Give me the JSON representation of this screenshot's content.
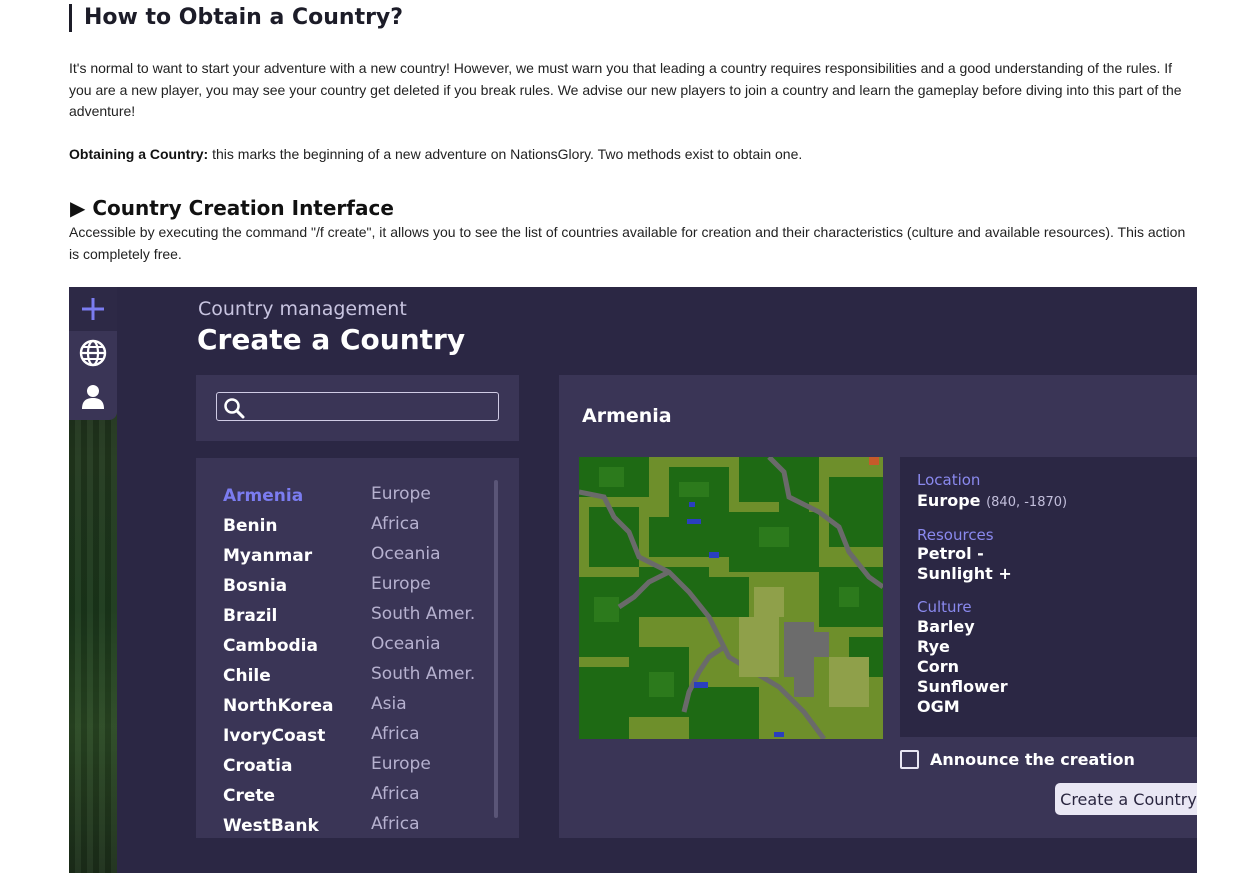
{
  "article": {
    "heading": "How to Obtain a Country?",
    "intro": "It's normal to want to start your adventure with a new country! However, we must warn you that leading a country requires responsibilities and a good understanding of the rules. If you are a new player, you may see your country get deleted if you break rules. We advise our new players to join a country and learn the gameplay before diving into this part of the adventure!",
    "obtaining_label": "Obtaining a Country:",
    "obtaining_text": " this marks the beginning of a new adventure on NationsGlory. Two methods exist to obtain one.",
    "section_title": "▶ Country Creation Interface",
    "section_text": "Accessible by executing the command \"/f create\", it allows you to see the list of countries available for creation and their characteristics (culture and available resources). This action is completely free."
  },
  "game_ui": {
    "subtitle": "Country management",
    "title": "Create a Country",
    "search": {
      "value": "",
      "placeholder": ""
    },
    "countries": [
      {
        "name": "Armenia",
        "region": "Europe",
        "selected": true
      },
      {
        "name": "Benin",
        "region": "Africa"
      },
      {
        "name": "Myanmar",
        "region": "Oceania"
      },
      {
        "name": "Bosnia",
        "region": "Europe"
      },
      {
        "name": "Brazil",
        "region": "South Amer."
      },
      {
        "name": "Cambodia",
        "region": "Oceania"
      },
      {
        "name": "Chile",
        "region": "South Amer."
      },
      {
        "name": "NorthKorea",
        "region": "Asia"
      },
      {
        "name": "IvoryCoast",
        "region": "Africa"
      },
      {
        "name": "Croatia",
        "region": "Europe"
      },
      {
        "name": "Crete",
        "region": "Africa"
      },
      {
        "name": "WestBank",
        "region": "Africa"
      }
    ],
    "detail": {
      "country": "Armenia",
      "location_label": "Location",
      "location_value": "Europe",
      "location_coords": "(840, -1870)",
      "resources_label": "Resources",
      "resources": [
        "Petrol -",
        "Sunlight +"
      ],
      "culture_label": "Culture",
      "culture": [
        "Barley",
        "Rye",
        "Corn",
        "Sunflower",
        "OGM"
      ]
    },
    "announce_label": "Announce the creation",
    "announce_checked": false,
    "create_button": "Create a Country"
  },
  "colors": {
    "panel_dark": "#2b2744",
    "panel_mid": "#3a3556",
    "accent": "#7b7cf0",
    "text_light": "#ffffff",
    "region_text": "#b6b1cf"
  },
  "icons": [
    "plus-icon",
    "globe-icon",
    "user-icon",
    "close-icon",
    "search-icon"
  ]
}
